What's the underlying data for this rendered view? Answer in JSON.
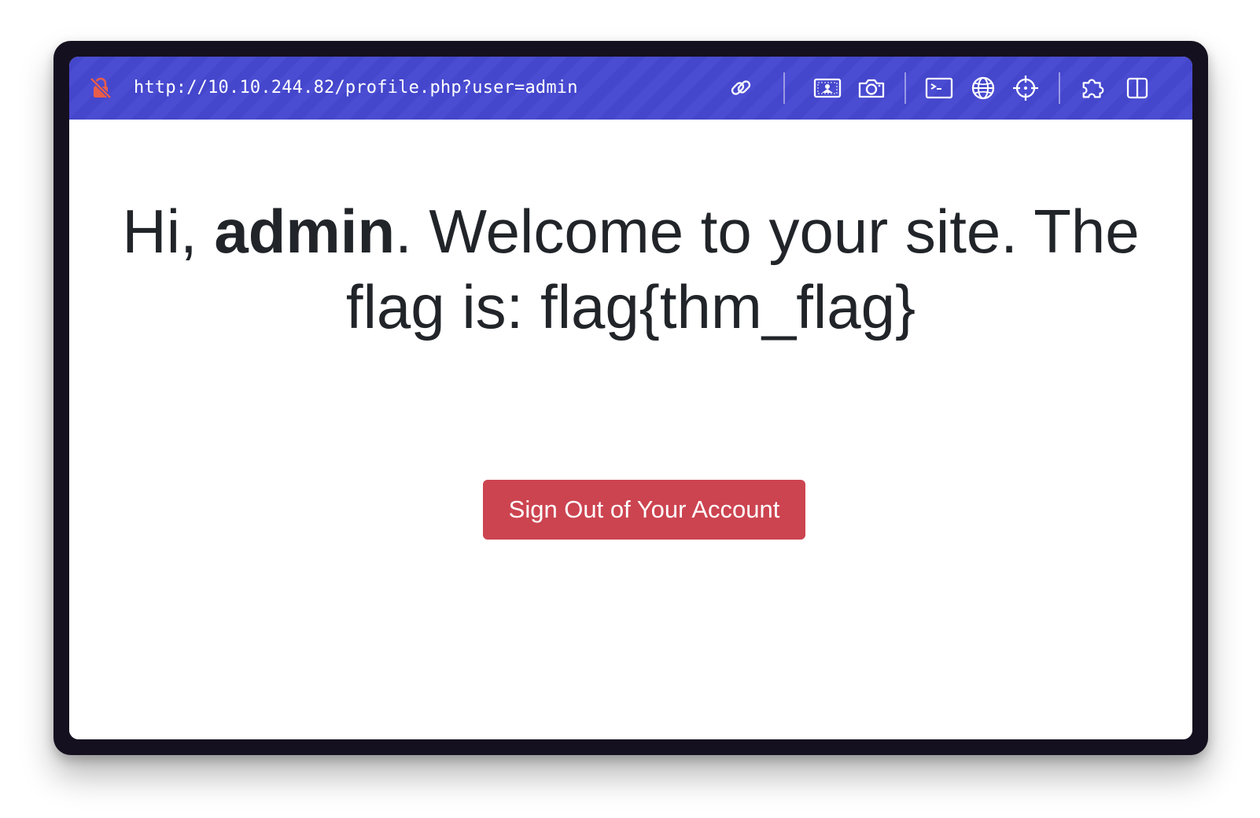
{
  "browser": {
    "url": "http://10.10.244.82/profile.php?user=admin",
    "toolbar_color": "#4446cc",
    "insecure_icon_color": "#e85d4a",
    "icons": [
      "insecure-lock-icon",
      "link-icon",
      "image-icon",
      "camera-icon",
      "terminal-icon",
      "globe-icon",
      "crosshair-icon",
      "puzzle-icon",
      "split-view-icon"
    ]
  },
  "page": {
    "greeting_prefix": "Hi, ",
    "username": "admin",
    "greeting_suffix": ". Welcome to your site. The flag is: flag{thm_flag}",
    "signout_label": "Sign Out of Your Account",
    "text_color": "#212529",
    "button_color": "#cc4450"
  }
}
